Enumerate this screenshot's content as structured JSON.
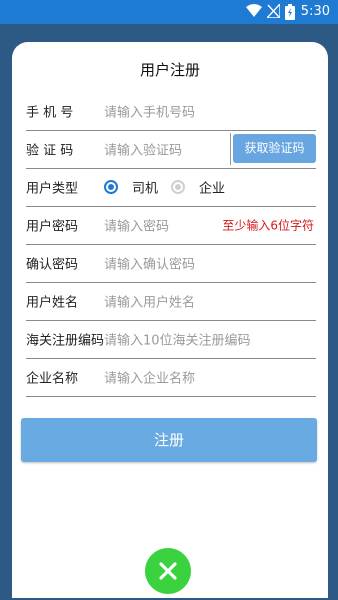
{
  "status_bar": {
    "time": "5:30",
    "icons": [
      "wifi-icon",
      "signal-icon",
      "battery-icon"
    ]
  },
  "form": {
    "title": "用户注册",
    "phone": {
      "label": "手 机 号",
      "placeholder": "请输入手机号码"
    },
    "code": {
      "label": "验 证 码",
      "placeholder": "请输入验证码",
      "button": "获取验证码"
    },
    "user_type": {
      "label": "用户类型",
      "options": [
        {
          "label": "司机",
          "selected": true
        },
        {
          "label": "企业",
          "selected": false
        }
      ]
    },
    "password": {
      "label": "用户密码",
      "placeholder": "请输入密码",
      "hint": "至少输入6位字符"
    },
    "confirm": {
      "label": "确认密码",
      "placeholder": "请输入确认密码"
    },
    "name": {
      "label": "用户姓名",
      "placeholder": "请输入用户姓名"
    },
    "customs": {
      "label": "海关注册编码",
      "placeholder": "请输入10位海关注册编码"
    },
    "company": {
      "label": "企业名称",
      "placeholder": "请输入企业名称"
    },
    "submit": "注册"
  },
  "close_button": {
    "icon": "close-icon"
  },
  "colors": {
    "accent": "#1f7ad4",
    "button": "#69aae2",
    "warning": "#d51a1a",
    "close": "#3bd240",
    "background": "#2d5a84"
  }
}
